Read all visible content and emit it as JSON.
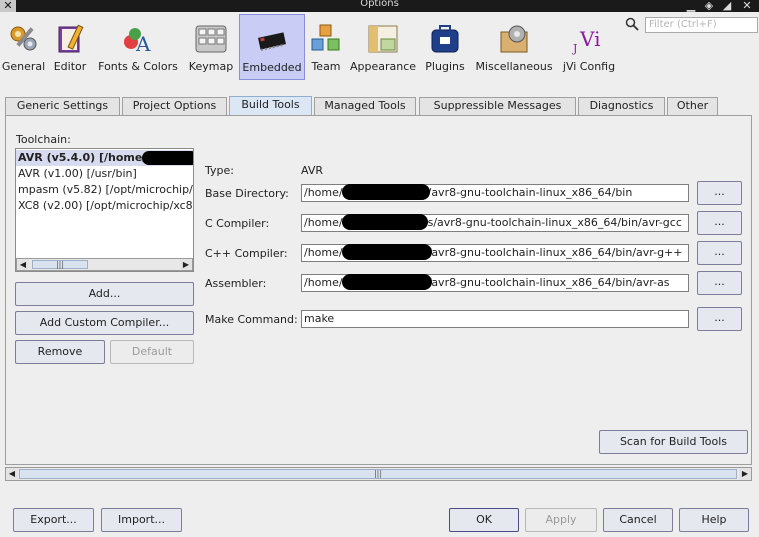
{
  "window": {
    "title": "Options",
    "controls": [
      "minimize-icon",
      "restore-icon",
      "maximize-icon",
      "close-icon"
    ]
  },
  "categories": [
    {
      "id": "general",
      "label": "General",
      "icon": "gears-wrench-icon"
    },
    {
      "id": "editor",
      "label": "Editor",
      "icon": "notebook-pencil-icon"
    },
    {
      "id": "fonts",
      "label": "Fonts & Colors",
      "icon": "palette-letter-icon"
    },
    {
      "id": "keymap",
      "label": "Keymap",
      "icon": "keyboard-keys-icon"
    },
    {
      "id": "embedded",
      "label": "Embedded",
      "icon": "microchip-icon",
      "selected": true
    },
    {
      "id": "team",
      "label": "Team",
      "icon": "colored-cubes-icon"
    },
    {
      "id": "appearance",
      "label": "Appearance",
      "icon": "window-layout-icon"
    },
    {
      "id": "plugins",
      "label": "Plugins",
      "icon": "plugin-briefcase-icon"
    },
    {
      "id": "misc",
      "label": "Miscellaneous",
      "icon": "toolbox-gear-icon"
    },
    {
      "id": "jvi",
      "label": "jVi Config",
      "icon": "jvi-letters-icon"
    }
  ],
  "filter": {
    "placeholder": "Filter (Ctrl+F)",
    "value": ""
  },
  "tabs": [
    {
      "label": "Generic Settings"
    },
    {
      "label": "Project Options"
    },
    {
      "label": "Build Tools",
      "active": true
    },
    {
      "label": "Managed Tools"
    },
    {
      "label": "Suppressible Messages"
    },
    {
      "label": "Diagnostics"
    },
    {
      "label": "Other"
    }
  ],
  "toolchain": {
    "label": "Toolchain:",
    "items": [
      {
        "text": "AVR (v5.4.0) [/home/",
        "selected": true
      },
      {
        "text": "AVR (v1.00) [/usr/bin]"
      },
      {
        "text": "mpasm (v5.82) [/opt/microchip/"
      },
      {
        "text": "XC8 (v2.00) [/opt/microchip/xc8"
      }
    ],
    "buttons": {
      "add": "Add...",
      "add_custom": "Add Custom Compiler...",
      "remove": "Remove",
      "default": "Default"
    }
  },
  "details": {
    "type_label": "Type:",
    "type_value": "AVR",
    "base_dir_label": "Base Directory:",
    "base_dir_start": "/home/",
    "base_dir_end": "/avr8-gnu-toolchain-linux_x86_64/bin",
    "c_compiler_label": "C Compiler:",
    "c_compiler_start": "/home/",
    "c_compiler_end": "s/avr8-gnu-toolchain-linux_x86_64/bin/avr-gcc",
    "cpp_compiler_label": "C++ Compiler:",
    "cpp_compiler_start": "/home/",
    "cpp_compiler_end": "/avr8-gnu-toolchain-linux_x86_64/bin/avr-g++",
    "assembler_label": "Assembler:",
    "assembler_start": "/home/",
    "assembler_end": "/avr8-gnu-toolchain-linux_x86_64/bin/avr-as",
    "make_label": "Make Command:",
    "make_value": "make",
    "browse_label": "..."
  },
  "scan_button": "Scan for Build Tools",
  "footer": {
    "export": "Export...",
    "import": "Import...",
    "ok": "OK",
    "apply": "Apply",
    "cancel": "Cancel",
    "help": "Help"
  }
}
